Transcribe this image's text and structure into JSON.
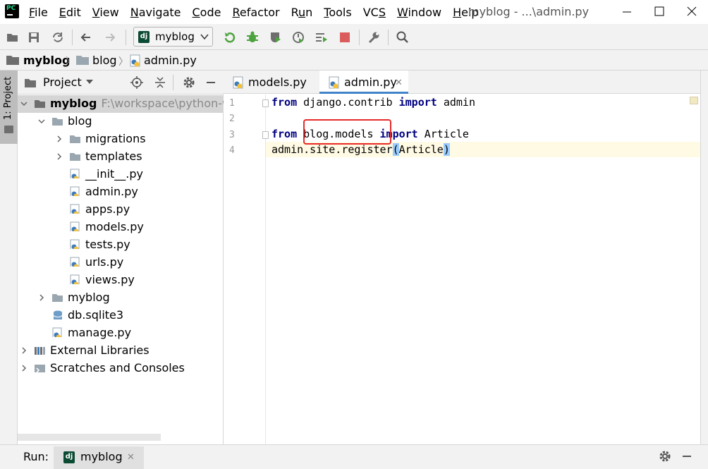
{
  "window": {
    "title": "myblog - ...\\admin.py",
    "app_icon_text": "PC"
  },
  "menu": [
    {
      "label": "File",
      "mnemonic": "F"
    },
    {
      "label": "Edit",
      "mnemonic": "E"
    },
    {
      "label": "View",
      "mnemonic": "V"
    },
    {
      "label": "Navigate",
      "mnemonic": "N"
    },
    {
      "label": "Code",
      "mnemonic": "C"
    },
    {
      "label": "Refactor",
      "mnemonic": "R"
    },
    {
      "label": "Run",
      "mnemonic": "u"
    },
    {
      "label": "Tools",
      "mnemonic": "T"
    },
    {
      "label": "VCS",
      "mnemonic": "S"
    },
    {
      "label": "Window",
      "mnemonic": "W"
    },
    {
      "label": "Help",
      "mnemonic": "H"
    }
  ],
  "toolbar": {
    "run_config": "myblog",
    "run_config_icon_text": "dj"
  },
  "breadcrumb": [
    "myblog",
    "blog",
    "admin.py"
  ],
  "left_strip": {
    "project_tab_label": "1: Project"
  },
  "project_panel": {
    "title": "Project",
    "tree": [
      {
        "label": "myblog",
        "path": "F:\\workspace\\python-wo",
        "type": "folder",
        "expanded": true,
        "level": 0
      },
      {
        "label": "blog",
        "type": "folder",
        "expanded": true,
        "level": 1
      },
      {
        "label": "migrations",
        "type": "folder",
        "expanded": false,
        "level": 2
      },
      {
        "label": "templates",
        "type": "folder",
        "expanded": false,
        "level": 2
      },
      {
        "label": "__init__.py",
        "type": "python",
        "level": 2
      },
      {
        "label": "admin.py",
        "type": "python",
        "level": 2
      },
      {
        "label": "apps.py",
        "type": "python",
        "level": 2
      },
      {
        "label": "models.py",
        "type": "python",
        "level": 2
      },
      {
        "label": "tests.py",
        "type": "python",
        "level": 2
      },
      {
        "label": "urls.py",
        "type": "python",
        "level": 2
      },
      {
        "label": "views.py",
        "type": "python",
        "level": 2
      },
      {
        "label": "myblog",
        "type": "folder",
        "expanded": false,
        "level": 1
      },
      {
        "label": "db.sqlite3",
        "type": "database",
        "level": 1
      },
      {
        "label": "manage.py",
        "type": "python",
        "level": 1
      },
      {
        "label": "External Libraries",
        "type": "library",
        "expanded": false,
        "level": 0
      },
      {
        "label": "Scratches and Consoles",
        "type": "scratch",
        "expanded": false,
        "level": 0
      }
    ]
  },
  "editor": {
    "tabs": [
      {
        "label": "models.py",
        "active": false
      },
      {
        "label": "admin.py",
        "active": true
      }
    ],
    "line_numbers": [
      "1",
      "2",
      "3",
      "4"
    ],
    "lines": [
      {
        "kw1": "from",
        "mid": " django.contrib ",
        "kw2": "import",
        "tail": " admin"
      },
      {},
      {
        "kw1": "from",
        "mid": " blog.models ",
        "kw2": "import",
        "tail": " Article"
      },
      {
        "pre": "admin.site.register",
        "open": "(",
        "arg": "Article",
        "close": ")"
      }
    ],
    "current_line": 4,
    "highlighted_text": "blog.models"
  },
  "run_bar": {
    "label": "Run:",
    "tab_label": "myblog",
    "tab_icon_text": "dj"
  },
  "colors": {
    "keyword": "#000080",
    "highlight_box": "#e82a2a",
    "current_line_bg": "#fffae3",
    "brace_match": "#99ccff",
    "active_tab_underline": "#4083c9",
    "folder": "#9aa7b0"
  }
}
